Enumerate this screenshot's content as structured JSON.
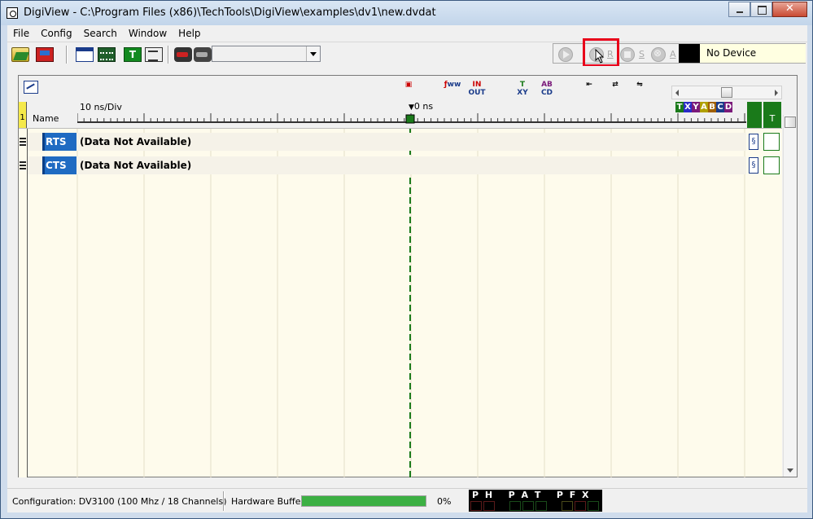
{
  "window": {
    "title": "DigiView - C:\\Program Files (x86)\\TechTools\\DigiView\\examples\\dv1\\new.dvdat"
  },
  "menu": [
    "File",
    "Config",
    "Search",
    "Window",
    "Help"
  ],
  "toolbar": {
    "icons": [
      "open-file-icon",
      "save-file-icon",
      "window-icon",
      "channels-icon",
      "timing-icon",
      "list-icon",
      "capture-setup-icon",
      "capture-settings-icon"
    ],
    "combo_value": ""
  },
  "device": {
    "buttons": [
      {
        "name": "play",
        "label": ""
      },
      {
        "name": "run",
        "label": "R"
      },
      {
        "name": "stop",
        "label": "S"
      },
      {
        "name": "abort",
        "label": "A"
      }
    ],
    "status": "No Device"
  },
  "plot": {
    "one_label": "1",
    "name_header": "Name",
    "time_per_div": "10 ns/Div",
    "zero_label": "0 ns",
    "header_letters": [
      {
        "letter": "T",
        "color": "#1a7a1a"
      },
      {
        "letter": "X",
        "color": "#2b2bc8"
      },
      {
        "letter": "Y",
        "color": "#7a1a7a"
      },
      {
        "letter": "A",
        "color": "#b0a000"
      },
      {
        "letter": "B",
        "color": "#a06000"
      },
      {
        "letter": "C",
        "color": "#1a3b8a"
      },
      {
        "letter": "D",
        "color": "#7a1a7a"
      }
    ],
    "t_column": "T",
    "signals": [
      {
        "name": "RTS",
        "status": "(Data Not Available)"
      },
      {
        "name": "CTS",
        "status": "(Data Not Available)"
      }
    ]
  },
  "status_bar": {
    "configuration": "Configuration:   DV3100 (100 Mhz / 18 Channels)",
    "hw_buffer_label": "Hardware Buffer:",
    "hw_buffer_fraction": 1.0,
    "hw_buffer_percent": "0%",
    "flags_text": "P H   P A T   P F X"
  },
  "colors": {
    "plot_background": "#fefbec",
    "signal_badge": "#1f6bc2",
    "cursor_line": "#1a7a1a",
    "highlight": "#e8001a"
  }
}
